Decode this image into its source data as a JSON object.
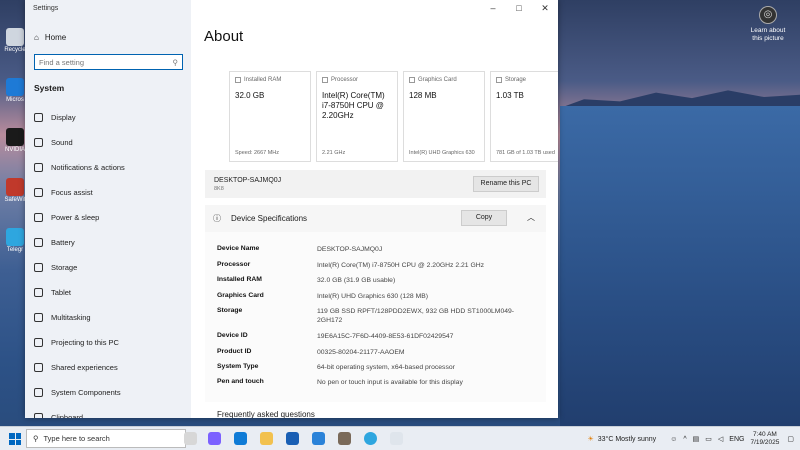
{
  "desktop": {
    "icons": [
      {
        "label": "Recycle",
        "color": "#cfd6df"
      },
      {
        "label": "Micros",
        "color": "#1e7ad6"
      },
      {
        "label": "NVIDIA",
        "color": "#1a1a1a"
      },
      {
        "label": "SafeWit",
        "color": "#c0392b"
      },
      {
        "label": "Telegr",
        "color": "#2ea6df"
      }
    ],
    "learn": "Learn about this picture"
  },
  "window": {
    "title": "Settings",
    "controls": [
      "–",
      "□",
      "✕"
    ]
  },
  "sidebar": {
    "home": "Home",
    "search_placeholder": "Find a setting",
    "section": "System",
    "items": [
      {
        "label": "Display",
        "icon": "display-icon"
      },
      {
        "label": "Sound",
        "icon": "sound-icon"
      },
      {
        "label": "Notifications & actions",
        "icon": "notifications-icon"
      },
      {
        "label": "Focus assist",
        "icon": "moon-icon"
      },
      {
        "label": "Power & sleep",
        "icon": "power-icon"
      },
      {
        "label": "Battery",
        "icon": "battery-icon"
      },
      {
        "label": "Storage",
        "icon": "storage-icon"
      },
      {
        "label": "Tablet",
        "icon": "tablet-icon"
      },
      {
        "label": "Multitasking",
        "icon": "multitasking-icon"
      },
      {
        "label": "Projecting to this PC",
        "icon": "project-icon"
      },
      {
        "label": "Shared experiences",
        "icon": "shared-icon"
      },
      {
        "label": "System Components",
        "icon": "components-icon"
      },
      {
        "label": "Clipboard",
        "icon": "clipboard-icon"
      }
    ]
  },
  "about": {
    "title": "About",
    "cards": [
      {
        "head": "Installed RAM",
        "value": "32.0 GB",
        "sub": "Speed: 2667 MHz"
      },
      {
        "head": "Processor",
        "value": "Intel(R) Core(TM) i7-8750H CPU @ 2.20GHz",
        "sub": "2.21 GHz"
      },
      {
        "head": "Graphics Card",
        "value": "128 MB",
        "sub": "Intel(R) UHD Graphics 630"
      },
      {
        "head": "Storage",
        "value": "1.03 TB",
        "sub": "781 GB of 1.03 TB used"
      }
    ],
    "pc_name": "DESKTOP-SAJMQ0J",
    "pc_sub": "8K8",
    "rename_button": "Rename this PC",
    "specs_title": "Device Specifications",
    "copy_button": "Copy",
    "specs": [
      {
        "key": "Device Name",
        "value": "DESKTOP-SAJMQ0J"
      },
      {
        "key": "Processor",
        "value": "Intel(R) Core(TM) i7-8750H CPU @ 2.20GHz   2.21 GHz"
      },
      {
        "key": "Installed RAM",
        "value": "32.0 GB (31.9 GB usable)"
      },
      {
        "key": "Graphics Card",
        "value": "Intel(R) UHD Graphics 630 (128 MB)"
      },
      {
        "key": "Storage",
        "value": "119 GB SSD RPFT/128PDD2EWX, 932 GB HDD ST1000LM049-2GH172"
      },
      {
        "key": "Device ID",
        "value": "19E6A15C-7F6D-4409-8E53-61DF02429547"
      },
      {
        "key": "Product ID",
        "value": "00325-80204-21177-AAOEM"
      },
      {
        "key": "System Type",
        "value": "64-bit operating system, x64-based processor"
      },
      {
        "key": "Pen and touch",
        "value": "No pen or touch input is available for this display"
      }
    ],
    "faq": "Frequently asked questions"
  },
  "taskbar": {
    "search_placeholder": "Type here to search",
    "weather": "33°C  Mostly sunny",
    "lang": "ENG",
    "time": "7:40 AM",
    "date": "7/19/2025"
  }
}
